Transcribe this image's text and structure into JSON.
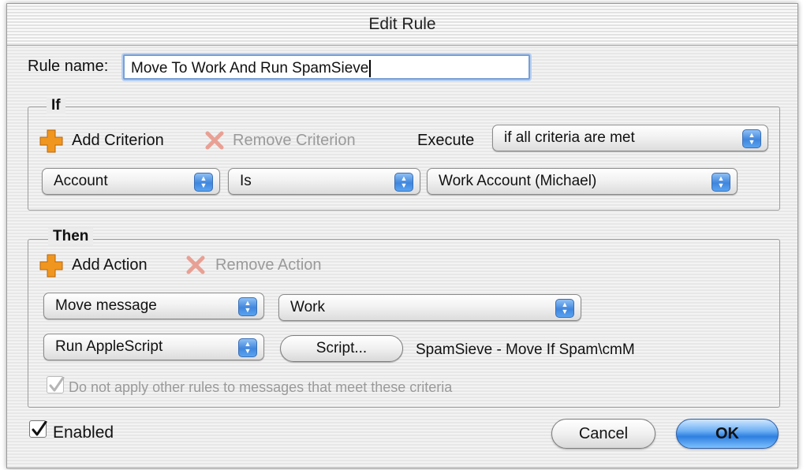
{
  "window": {
    "title": "Edit Rule"
  },
  "rule_name": {
    "label": "Rule name:",
    "value": "Move To Work And Run SpamSieve"
  },
  "if_group": {
    "label": "If",
    "add_criterion": "Add Criterion",
    "remove_criterion": "Remove Criterion",
    "execute_label": "Execute",
    "execute_value": "if all criteria are met",
    "criterion": {
      "field": "Account",
      "operator": "Is",
      "value": "Work Account (Michael)"
    }
  },
  "then_group": {
    "label": "Then",
    "add_action": "Add Action",
    "remove_action": "Remove Action",
    "action1": {
      "type": "Move message",
      "target": "Work"
    },
    "action2": {
      "type": "Run AppleScript",
      "button": "Script...",
      "script_name": "SpamSieve - Move If Spam\\cmM"
    },
    "stop_rules": {
      "label": "Do not apply other rules to messages that meet these criteria",
      "checked": true,
      "enabled": false
    }
  },
  "enabled": {
    "label": "Enabled",
    "checked": true
  },
  "buttons": {
    "cancel": "Cancel",
    "ok": "OK"
  },
  "colors": {
    "add_icon": "#f0961e",
    "remove_icon": "#e06050",
    "default_button": "#2e7fe0",
    "focus_ring": "#7a9fd4"
  }
}
